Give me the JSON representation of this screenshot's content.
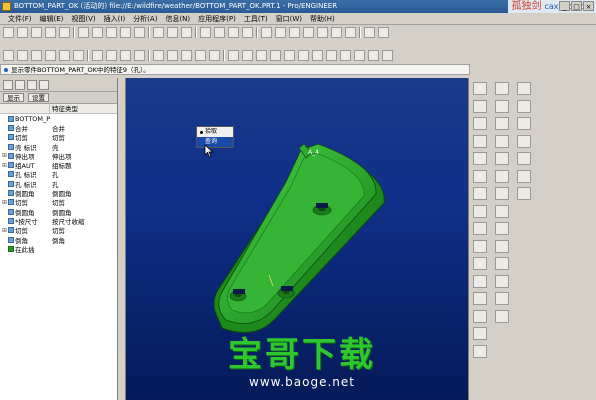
{
  "window": {
    "title": "BOTTOM_PART_OK (活动的) file://E:/wildfire/weather/BOTTOM_PART_OK.PRT.1 - Pro/ENGINEER",
    "controls": [
      "_",
      "□",
      "×"
    ]
  },
  "watermark_top": {
    "text": "孤独剑",
    "url": "caxinfo.com"
  },
  "menu": [
    "文件(F)",
    "编辑(E)",
    "视图(V)",
    "插入(I)",
    "分析(A)",
    "信息(N)",
    "应用程序(P)",
    "工具(T)",
    "窗口(W)",
    "帮助(H)"
  ],
  "message": "显示零件BOTTOM_PART_OK中的特征9（孔）。",
  "model_tree": {
    "tools": [
      "显示",
      "设置"
    ],
    "header": [
      "",
      "特征类型"
    ],
    "rows": [
      {
        "name": "BOTTOM_P",
        "type": ""
      },
      {
        "name": "合并",
        "type": "合并"
      },
      {
        "name": "切剪",
        "type": "切剪"
      },
      {
        "name": "壳 标识",
        "type": "壳"
      },
      {
        "name": "伸出项",
        "type": "伸出项"
      },
      {
        "name": "组AUT",
        "type": "组标题"
      },
      {
        "name": "孔 标识",
        "type": "孔"
      },
      {
        "name": "孔 标识",
        "type": "孔"
      },
      {
        "name": "倒圆角",
        "type": "倒圆角"
      },
      {
        "name": "切剪",
        "type": "切剪"
      },
      {
        "name": "倒圆角",
        "type": "倒圆角"
      },
      {
        "name": "*按尺寸",
        "type": "按尺寸收缩"
      },
      {
        "name": "切剪",
        "type": "切剪"
      },
      {
        "name": "倒角",
        "type": "倒角"
      },
      {
        "name": "在此插",
        "type": ""
      }
    ]
  },
  "context_menu": {
    "items": [
      "拾取",
      "查询"
    ],
    "selected": "查询"
  },
  "model_label": "A_4",
  "watermark_big": {
    "text": "宝哥下载",
    "url": "www.baoge.net"
  },
  "colors": {
    "viewport_top": "#1a3a8a",
    "viewport_bottom": "#061a58",
    "model_fill": "#2ea82e",
    "title_bar": "#3a6ea5",
    "watermark_green": "#2ec82e"
  }
}
